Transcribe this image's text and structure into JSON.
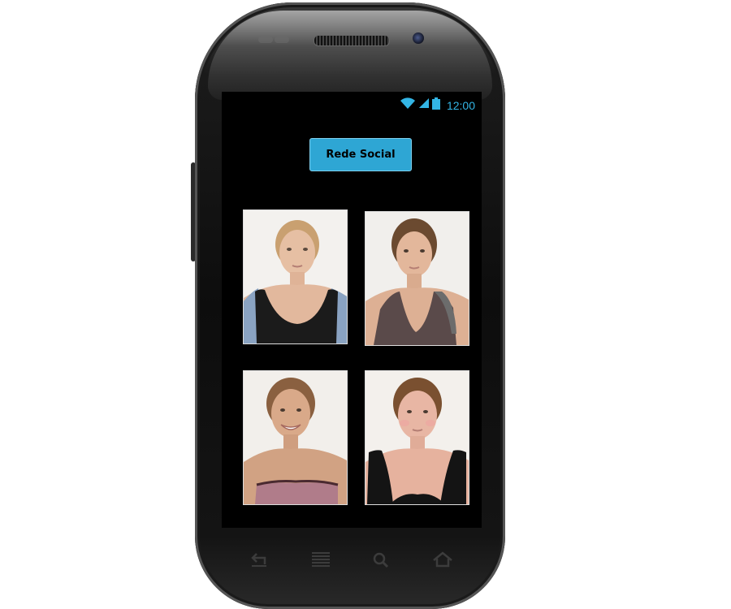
{
  "status_bar": {
    "time": "12:00",
    "wifi_icon": "wifi-icon",
    "signal_icon": "signal-icon",
    "battery_icon": "battery-icon",
    "accent_color": "#33b5e5"
  },
  "main": {
    "button_label": "Rede Social",
    "button_color": "#2ea6d4"
  },
  "photos": [
    {
      "name": "photo-1",
      "hair": "#c9a070",
      "top": "#1b1b1b",
      "top_accent": "#8aa3c2"
    },
    {
      "name": "photo-2",
      "hair": "#6b4a30",
      "top": "#5a4a4a",
      "top_accent": "#6c6c6c"
    },
    {
      "name": "photo-3",
      "hair": "#8a6040",
      "top": "#b07c8a",
      "top_accent": "#d2a8b6"
    },
    {
      "name": "photo-4",
      "hair": "#7a5030",
      "top": "#141414",
      "top_accent": "#141414"
    }
  ],
  "nav_keys": [
    "back-icon",
    "menu-icon",
    "search-icon",
    "home-icon"
  ]
}
